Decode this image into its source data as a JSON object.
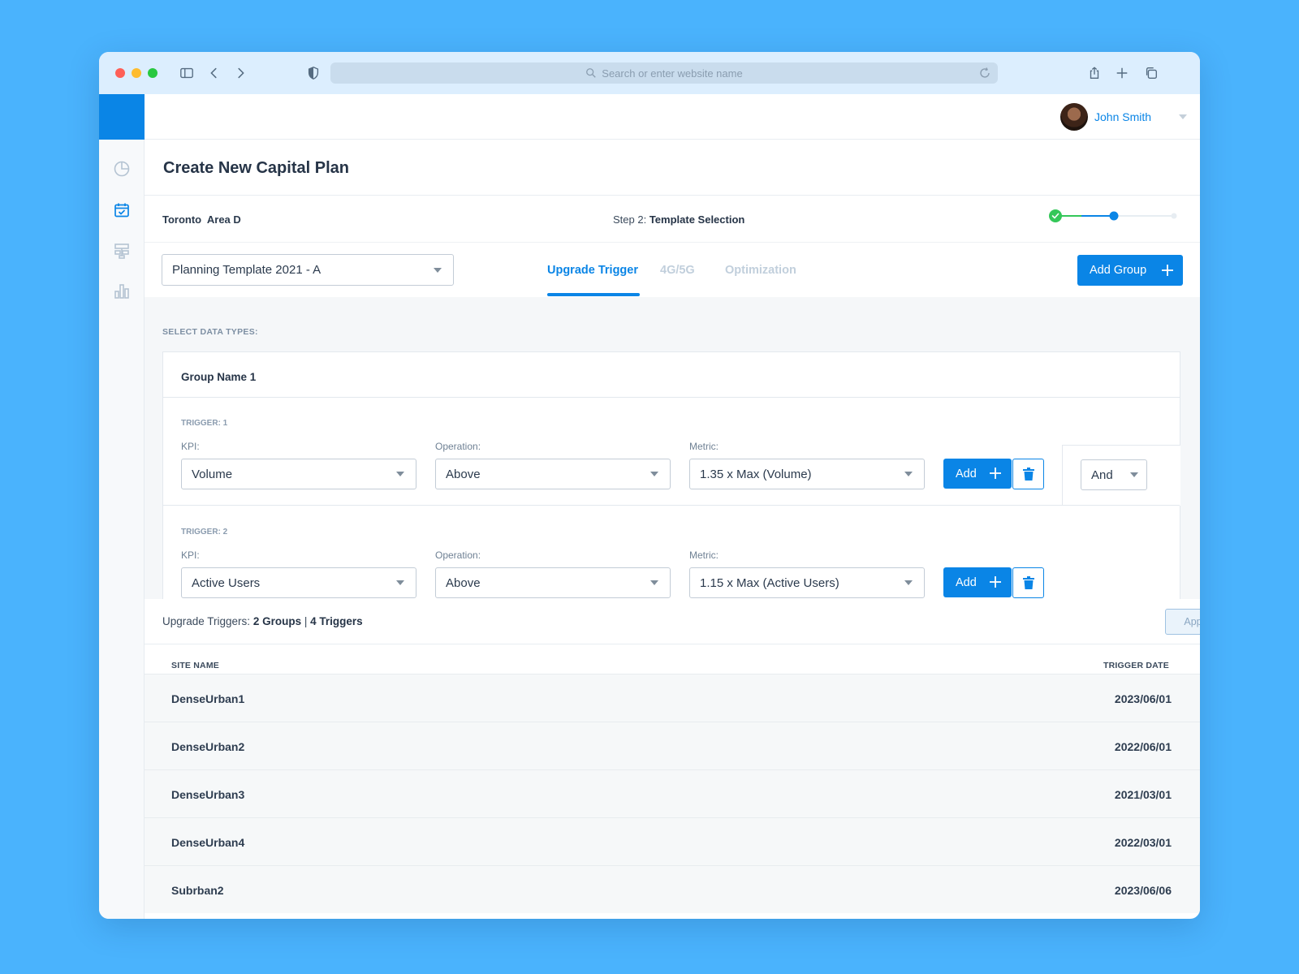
{
  "browser": {
    "address_placeholder": "Search or enter website name"
  },
  "user": {
    "name": "John Smith"
  },
  "page": {
    "title": "Create New Capital Plan",
    "location": "Toronto  Area D",
    "step_prefix": "Step 2:",
    "step_name": "Template Selection",
    "progress": {
      "steps_total": 3,
      "steps_completed": 1,
      "current_step": 2
    }
  },
  "template": {
    "selected": "Planning Template 2021 - A"
  },
  "tabs": [
    {
      "label": "Upgrade Trigger",
      "active": true
    },
    {
      "label": "4G/5G",
      "active": false
    },
    {
      "label": "Optimization",
      "active": false
    }
  ],
  "actions": {
    "add_group_label": "Add Group"
  },
  "panel": {
    "label": "SELECT DATA TYPES:",
    "group_name": "Group Name 1",
    "kpi_label": "KPI:",
    "operation_label": "Operation:",
    "metric_label": "Metric:",
    "add_label": "Add",
    "triggers": [
      {
        "label": "TRIGGER: 1",
        "kpi": "Volume",
        "operation": "Above",
        "metric": "1.35 x Max (Volume)"
      },
      {
        "label": "TRIGGER: 2",
        "kpi": "Active Users",
        "operation": "Above",
        "metric": "1.15 x Max (Active Users)"
      }
    ],
    "logic": "And"
  },
  "summary": {
    "prefix": "Upgrade Triggers:",
    "groups": "2 Groups",
    "separator": "|",
    "triggers": "4 Triggers",
    "apply_label": "Apply"
  },
  "table": {
    "headers": {
      "site": "SITE NAME",
      "date": "TRIGGER DATE"
    },
    "rows": [
      {
        "site": "DenseUrban1",
        "date": "2023/06/01"
      },
      {
        "site": "DenseUrban2",
        "date": "2022/06/01"
      },
      {
        "site": "DenseUrban3",
        "date": "2021/03/01"
      },
      {
        "site": "DenseUrban4",
        "date": "2022/03/01"
      },
      {
        "site": "Subrban2",
        "date": "2023/06/06"
      }
    ]
  },
  "colors": {
    "accent": "#0a85e6",
    "success": "#34c759",
    "background": "#4ab3fd"
  }
}
